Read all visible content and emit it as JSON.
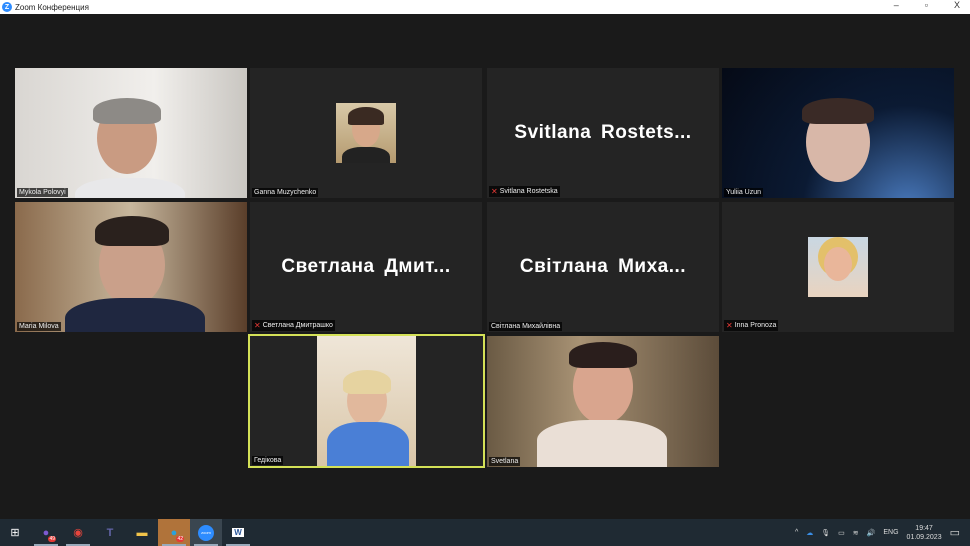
{
  "window": {
    "title": "Zoom Конференция",
    "minimize": "–",
    "maximize": "▫",
    "close": "X"
  },
  "participants": [
    {
      "name": "Mykola Polovyi",
      "type": "video",
      "muted": false
    },
    {
      "name": "Ganna Muzychenko",
      "type": "avatar",
      "muted": false
    },
    {
      "name": "Svitlana Rostetska",
      "display": "Svitlana  Rostets...",
      "type": "name",
      "muted": true
    },
    {
      "name": "Yuliia Uzun",
      "type": "video",
      "muted": false
    },
    {
      "name": "Maria Milova",
      "type": "video",
      "muted": false
    },
    {
      "name": "Светлана Дмитрашко",
      "display": "Светлана  Дмит...",
      "type": "name",
      "muted": true
    },
    {
      "name": "Світлана Михайлівна",
      "display": "Світлана  Миха...",
      "type": "name",
      "muted": false
    },
    {
      "name": "Inna Pronoza",
      "type": "avatar",
      "muted": true
    },
    {
      "name": "Гедікова",
      "type": "video",
      "muted": false,
      "active_speaker": true
    },
    {
      "name": "Svetlana",
      "type": "video",
      "muted": false
    }
  ],
  "taskbar": {
    "apps": [
      {
        "name": "Viber",
        "badge": "49"
      },
      {
        "name": "Chrome"
      },
      {
        "name": "Teams"
      },
      {
        "name": "File Explorer"
      },
      {
        "name": "Telegram",
        "badge": "42"
      },
      {
        "name": "Zoom",
        "label": "zoom"
      },
      {
        "name": "Word"
      }
    ],
    "tray": {
      "language": "ENG",
      "time": "19:47",
      "date": "01.09.2023"
    }
  },
  "colors": {
    "active_speaker": "#d4e157",
    "muted": "#e53935",
    "accent": "#2d8cff"
  }
}
